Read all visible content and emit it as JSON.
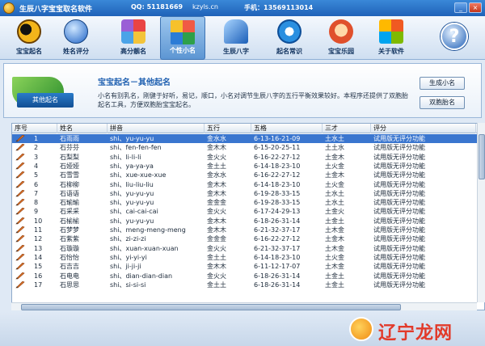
{
  "window": {
    "title": "生辰八字宝宝取名软件",
    "qq": "QQ: 51181669",
    "site": "kzyls.cn",
    "phone": "手机：13569113014",
    "min_label": "_",
    "close_label": "×"
  },
  "toolbar": {
    "items": [
      {
        "label": "宝宝起名",
        "icon": "yin-yang-icon"
      },
      {
        "label": "姓名评分",
        "icon": "globe-icon"
      },
      {
        "label": "高分靓名",
        "icon": "cubes-icon"
      },
      {
        "label": "个性小名",
        "icon": "squares-icon",
        "active": true
      },
      {
        "label": "生辰八字",
        "icon": "wings-icon"
      },
      {
        "label": "起名常识",
        "icon": "ie-icon"
      },
      {
        "label": "宝宝乐园",
        "icon": "headset-icon"
      },
      {
        "label": "关于软件",
        "icon": "windows-icon"
      },
      {
        "label": "",
        "icon": "help-icon"
      }
    ]
  },
  "header": {
    "badge": "其他起名",
    "title": "宝宝起名－其他起名",
    "description": "小名有别乳名，刚健于好听，易记，顺口，小名对调节生辰八字的五行平衡效果较好。本程序还提供了双胞胎起名工具，方便双胞胎宝宝起名。",
    "btn_small_name": "生成小名",
    "btn_twins": "双胞胎名"
  },
  "table": {
    "columns": [
      "序号",
      "姓名",
      "拼音",
      "五行",
      "五格",
      "三才",
      "评分"
    ],
    "rows": [
      [
        "1",
        "石雨雨",
        "shi、yu-yu-yu",
        "金水水",
        "6-13-16-21-09",
        "土水土",
        "试用版无评分功能"
      ],
      [
        "2",
        "石芬芬",
        "shi、fen-fen-fen",
        "金木木",
        "6-15-20-25-11",
        "土土水",
        "试用版无评分功能"
      ],
      [
        "3",
        "石梨梨",
        "shi、li-li-li",
        "金火火",
        "6-16-22-27-12",
        "土金木",
        "试用版无评分功能"
      ],
      [
        "4",
        "石娅娅",
        "shi、ya-ya-ya",
        "金土土",
        "6-14-18-23-10",
        "土火金",
        "试用版无评分功能"
      ],
      [
        "5",
        "石雪雪",
        "shi、xue-xue-xue",
        "金水水",
        "6-16-22-27-12",
        "土金木",
        "试用版无评分功能"
      ],
      [
        "6",
        "石柳柳",
        "shi、liu-liu-liu",
        "金木木",
        "6-14-18-23-10",
        "土火金",
        "试用版无评分功能"
      ],
      [
        "7",
        "石语语",
        "shi、yu-yu-yu",
        "金木木",
        "6-19-28-33-15",
        "土水土",
        "试用版无评分功能"
      ],
      [
        "8",
        "石瑜瑜",
        "shi、yu-yu-yu",
        "金金金",
        "6-19-28-33-15",
        "土水土",
        "试用版无评分功能"
      ],
      [
        "9",
        "石采采",
        "shi、cai-cai-cai",
        "金火火",
        "6-17-24-29-13",
        "土金火",
        "试用版无评分功能"
      ],
      [
        "10",
        "石榆榆",
        "shi、yu-yu-yu",
        "金木木",
        "6-18-26-31-14",
        "土金土",
        "试用版无评分功能"
      ],
      [
        "11",
        "石梦梦",
        "shi、meng-meng-meng",
        "金木木",
        "6-21-32-37-17",
        "土木金",
        "试用版无评分功能"
      ],
      [
        "12",
        "石紫紫",
        "shi、zi-zi-zi",
        "金金金",
        "6-16-22-27-12",
        "土金木",
        "试用版无评分功能"
      ],
      [
        "13",
        "石璇璇",
        "shi、xuan-xuan-xuan",
        "金火火",
        "6-21-32-37-17",
        "土木金",
        "试用版无评分功能"
      ],
      [
        "14",
        "石怡怡",
        "shi、yi-yi-yi",
        "金土土",
        "6-14-18-23-10",
        "土火金",
        "试用版无评分功能"
      ],
      [
        "15",
        "石吉吉",
        "shi、ji-ji-ji",
        "金木木",
        "6-11-12-17-07",
        "土木金",
        "试用版无评分功能"
      ],
      [
        "16",
        "石电电",
        "shi、dian-dian-dian",
        "金火火",
        "6-18-26-31-14",
        "土金土",
        "试用版无评分功能"
      ],
      [
        "17",
        "石思思",
        "shi、si-si-si",
        "金土土",
        "6-18-26-31-14",
        "土金土",
        "试用版无评分功能"
      ]
    ]
  },
  "watermark": "辽宁龙网",
  "colors": {
    "selection": "#3a76cf",
    "accent": "#1e5fb0",
    "watermark": "#e23a2a"
  }
}
